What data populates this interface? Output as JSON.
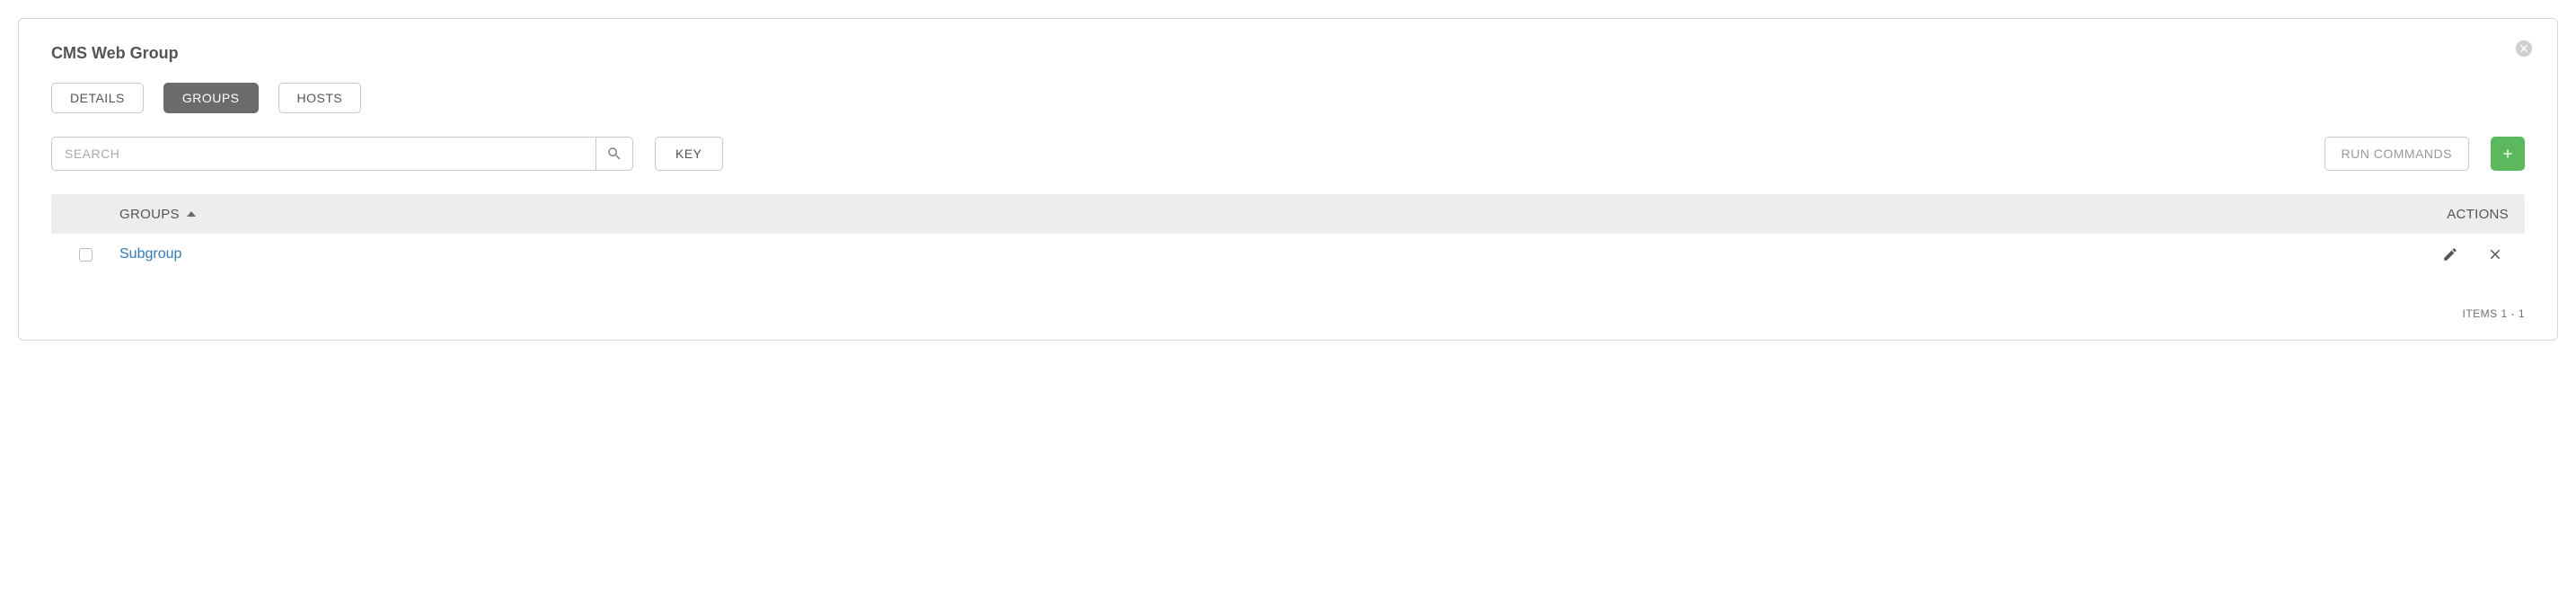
{
  "panel": {
    "title": "CMS Web Group"
  },
  "tabs": {
    "details": "DETAILS",
    "groups": "GROUPS",
    "hosts": "HOSTS",
    "active": "groups"
  },
  "toolbar": {
    "search_placeholder": "SEARCH",
    "key_label": "KEY",
    "run_commands_label": "RUN COMMANDS"
  },
  "table": {
    "header_groups": "GROUPS",
    "header_actions": "ACTIONS",
    "rows": [
      {
        "name": "Subgroup"
      }
    ]
  },
  "footer": {
    "items_label": "ITEMS  1 - 1"
  }
}
